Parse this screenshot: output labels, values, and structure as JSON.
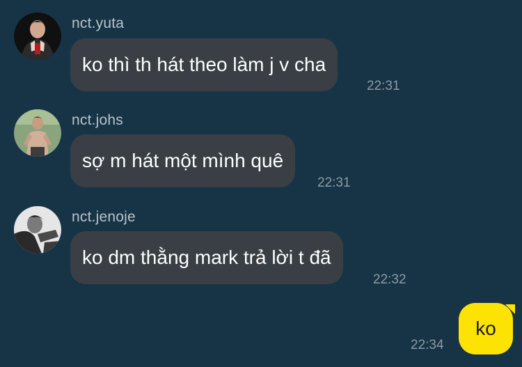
{
  "messages": [
    {
      "sender": "nct.yuta",
      "text": "ko thì th hát theo làm j v cha",
      "time": "22:31"
    },
    {
      "sender": "nct.johs",
      "text": "sợ m hát một mình quê",
      "time": "22:31"
    },
    {
      "sender": "nct.jenoje",
      "text": "ko dm thằng mark trả lời t đã",
      "time": "22:32"
    }
  ],
  "my_message": {
    "text": "ko",
    "time": "22:34"
  },
  "colors": {
    "background": "#163446",
    "incoming_bubble": "#3a3f45",
    "outgoing_bubble": "#fde303"
  }
}
